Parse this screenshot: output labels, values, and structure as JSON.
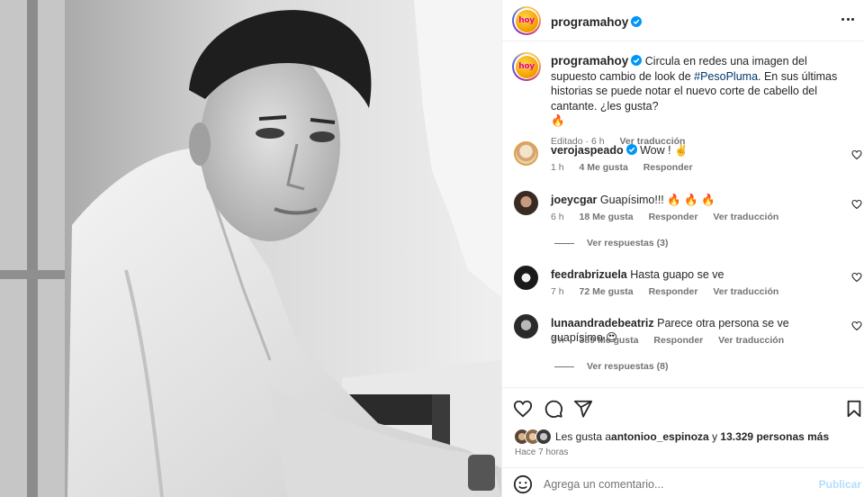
{
  "post": {
    "author": "programahoy",
    "logo_text": "hoy",
    "caption_prefix": "Circula en redes una imagen del supuesto cambio de look de ",
    "hashtag": "#PesoPluma",
    "caption_suffix": ". En sus últimas historias se puede notar el nuevo corte de cabello del cantante. ¿les gusta?",
    "caption_emoji": "🔥",
    "edited_label": "Editado",
    "caption_time": "6 h",
    "translate_label": "Ver traducción"
  },
  "comments": [
    {
      "user": "verojaspeado",
      "verified": true,
      "text": "Wow ! ✌️",
      "time": "1 h",
      "likes": "4 Me gusta",
      "reply": "Responder",
      "translate": ""
    },
    {
      "user": "joeycgar",
      "verified": false,
      "text": "Guapísimo!!! 🔥 🔥 🔥",
      "time": "6 h",
      "likes": "18 Me gusta",
      "reply": "Responder",
      "translate": "Ver traducción",
      "view_replies": "Ver respuestas (3)"
    },
    {
      "user": "feedrabrizuela",
      "verified": false,
      "text": "Hasta guapo se ve",
      "time": "7 h",
      "likes": "72 Me gusta",
      "reply": "Responder",
      "translate": "Ver traducción"
    },
    {
      "user": "lunaandradebeatriz",
      "verified": false,
      "text": "Parece otra persona se ve guapísimo 😍",
      "time": "7 h",
      "likes": "389 Me gusta",
      "reply": "Responder",
      "translate": "Ver traducción",
      "view_replies": "Ver respuestas (8)"
    }
  ],
  "engagement": {
    "likes_prefix": "Les gusta a ",
    "liked_by": "antonioo_espinoza",
    "connector": " y ",
    "others": "13.329 personas más",
    "posted_ago": "Hace 7 horas"
  },
  "composer": {
    "placeholder": "Agrega un comentario...",
    "post_label": "Publicar"
  },
  "icons": {
    "more": "more-options-icon",
    "verified": "verified-badge-icon",
    "like": "heart-icon",
    "comment": "comment-icon",
    "share": "share-icon",
    "save": "bookmark-icon",
    "emoji": "emoji-icon"
  },
  "colors": {
    "verified": "#0095f6",
    "hashtag": "#00376b",
    "muted": "#737373",
    "post_disabled": "#b2dffc"
  }
}
